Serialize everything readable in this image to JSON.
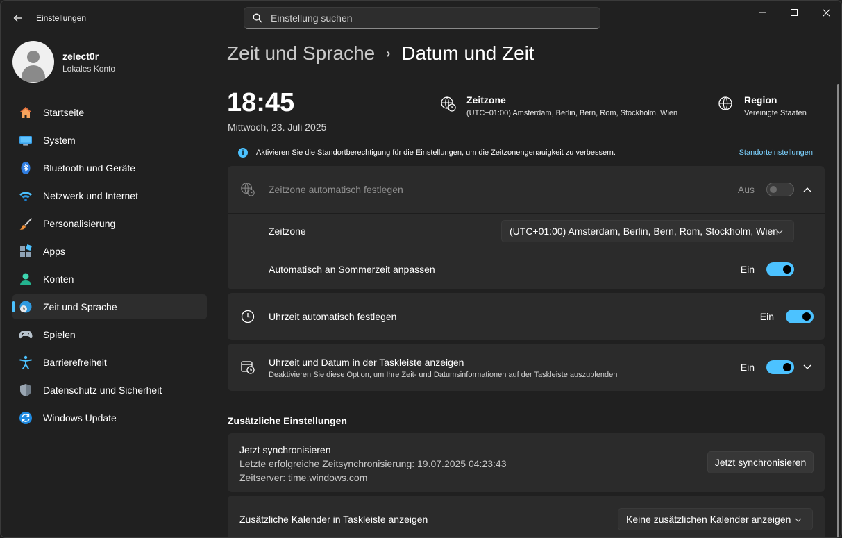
{
  "window": {
    "app_title": "Einstellungen",
    "search_placeholder": "Einstellung suchen"
  },
  "profile": {
    "name": "zelect0r",
    "account_type": "Lokales Konto"
  },
  "sidebar": {
    "items": [
      {
        "label": "Startseite",
        "icon": "home-icon"
      },
      {
        "label": "System",
        "icon": "system-icon"
      },
      {
        "label": "Bluetooth und Geräte",
        "icon": "bluetooth-icon"
      },
      {
        "label": "Netzwerk und Internet",
        "icon": "wifi-icon"
      },
      {
        "label": "Personalisierung",
        "icon": "brush-icon"
      },
      {
        "label": "Apps",
        "icon": "apps-icon"
      },
      {
        "label": "Konten",
        "icon": "account-icon"
      },
      {
        "label": "Zeit und Sprache",
        "icon": "globe-clock-icon",
        "active": true
      },
      {
        "label": "Spielen",
        "icon": "gamepad-icon"
      },
      {
        "label": "Barrierefreiheit",
        "icon": "accessibility-icon"
      },
      {
        "label": "Datenschutz und Sicherheit",
        "icon": "shield-icon"
      },
      {
        "label": "Windows Update",
        "icon": "update-icon"
      }
    ]
  },
  "breadcrumb": {
    "parent": "Zeit und Sprache",
    "separator": "›",
    "current": "Datum und Zeit"
  },
  "clock": {
    "time": "18:45",
    "date": "Mittwoch, 23. Juli 2025"
  },
  "timezone_info": {
    "title": "Zeitzone",
    "value": "(UTC+01:00) Amsterdam, Berlin, Bern, Rom, Stockholm, Wien"
  },
  "region_info": {
    "title": "Region",
    "value": "Vereinigte Staaten"
  },
  "notice": {
    "icon": "i",
    "text": "Aktivieren Sie die Standortberechtigung für die Einstellungen, um die Zeitzonengenauigkeit zu verbessern.",
    "link": "Standorteinstellungen"
  },
  "auto_timezone": {
    "label": "Zeitzone automatisch festlegen",
    "state": "Aus",
    "on": false
  },
  "timezone_select": {
    "label": "Zeitzone",
    "value": "(UTC+01:00) Amsterdam, Berlin, Bern, Rom, Stockholm, Wien"
  },
  "dst": {
    "label": "Automatisch an Sommerzeit anpassen",
    "state": "Ein",
    "on": true
  },
  "auto_time": {
    "label": "Uhrzeit automatisch festlegen",
    "state": "Ein",
    "on": true
  },
  "taskbar_clock": {
    "label": "Uhrzeit und Datum in der Taskleiste anzeigen",
    "description": "Deaktivieren Sie diese Option, um Ihre Zeit- und Datumsinformationen auf der Taskleiste auszublenden",
    "state": "Ein",
    "on": true
  },
  "additional": {
    "title": "Zusätzliche Einstellungen",
    "sync": {
      "title": "Jetzt synchronisieren",
      "last_sync": "Letzte erfolgreiche Zeitsynchronisierung: 19.07.2025 04:23:43",
      "server": "Zeitserver: time.windows.com",
      "button": "Jetzt synchronisieren"
    },
    "calendar": {
      "label": "Zusätzliche Kalender in Taskleiste anzeigen",
      "value": "Keine zusätzlichen Kalender anzeigen"
    }
  },
  "colors": {
    "accent": "#4cc2ff",
    "background": "#202020",
    "card": "#2b2b2b"
  }
}
